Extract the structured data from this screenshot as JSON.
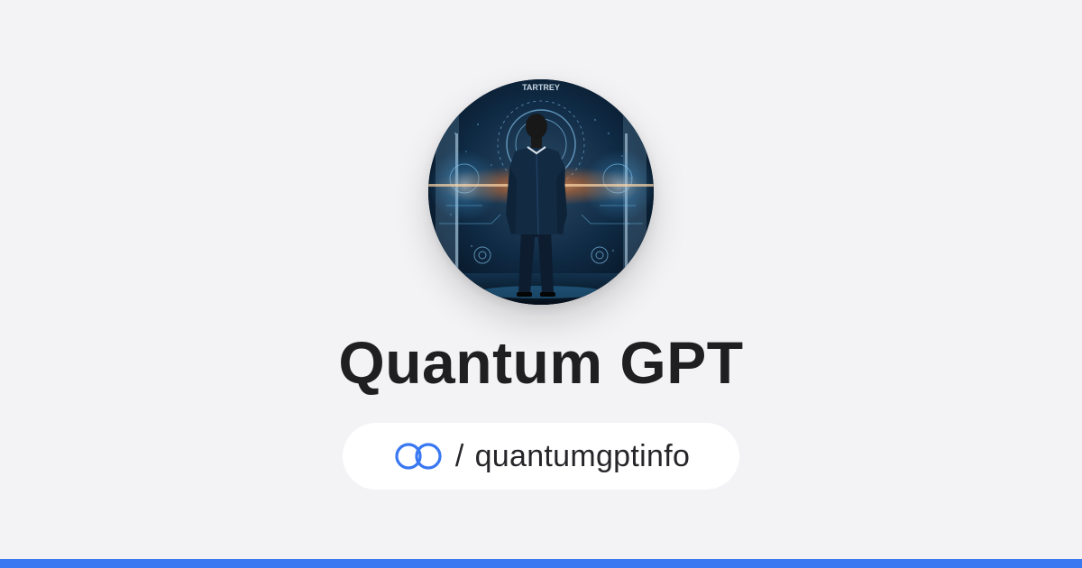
{
  "profile": {
    "name": "Quantum GPT",
    "separator": "/",
    "handle": "quantumgptinfo",
    "avatar_alt": "Quantum GPT avatar",
    "link_icon": "link-icon",
    "avatar_sign_text": "TARTREY"
  },
  "colors": {
    "background": "#f3f3f5",
    "title": "#1f1f22",
    "accent": "#3a78f2",
    "pill": "#ffffff"
  }
}
